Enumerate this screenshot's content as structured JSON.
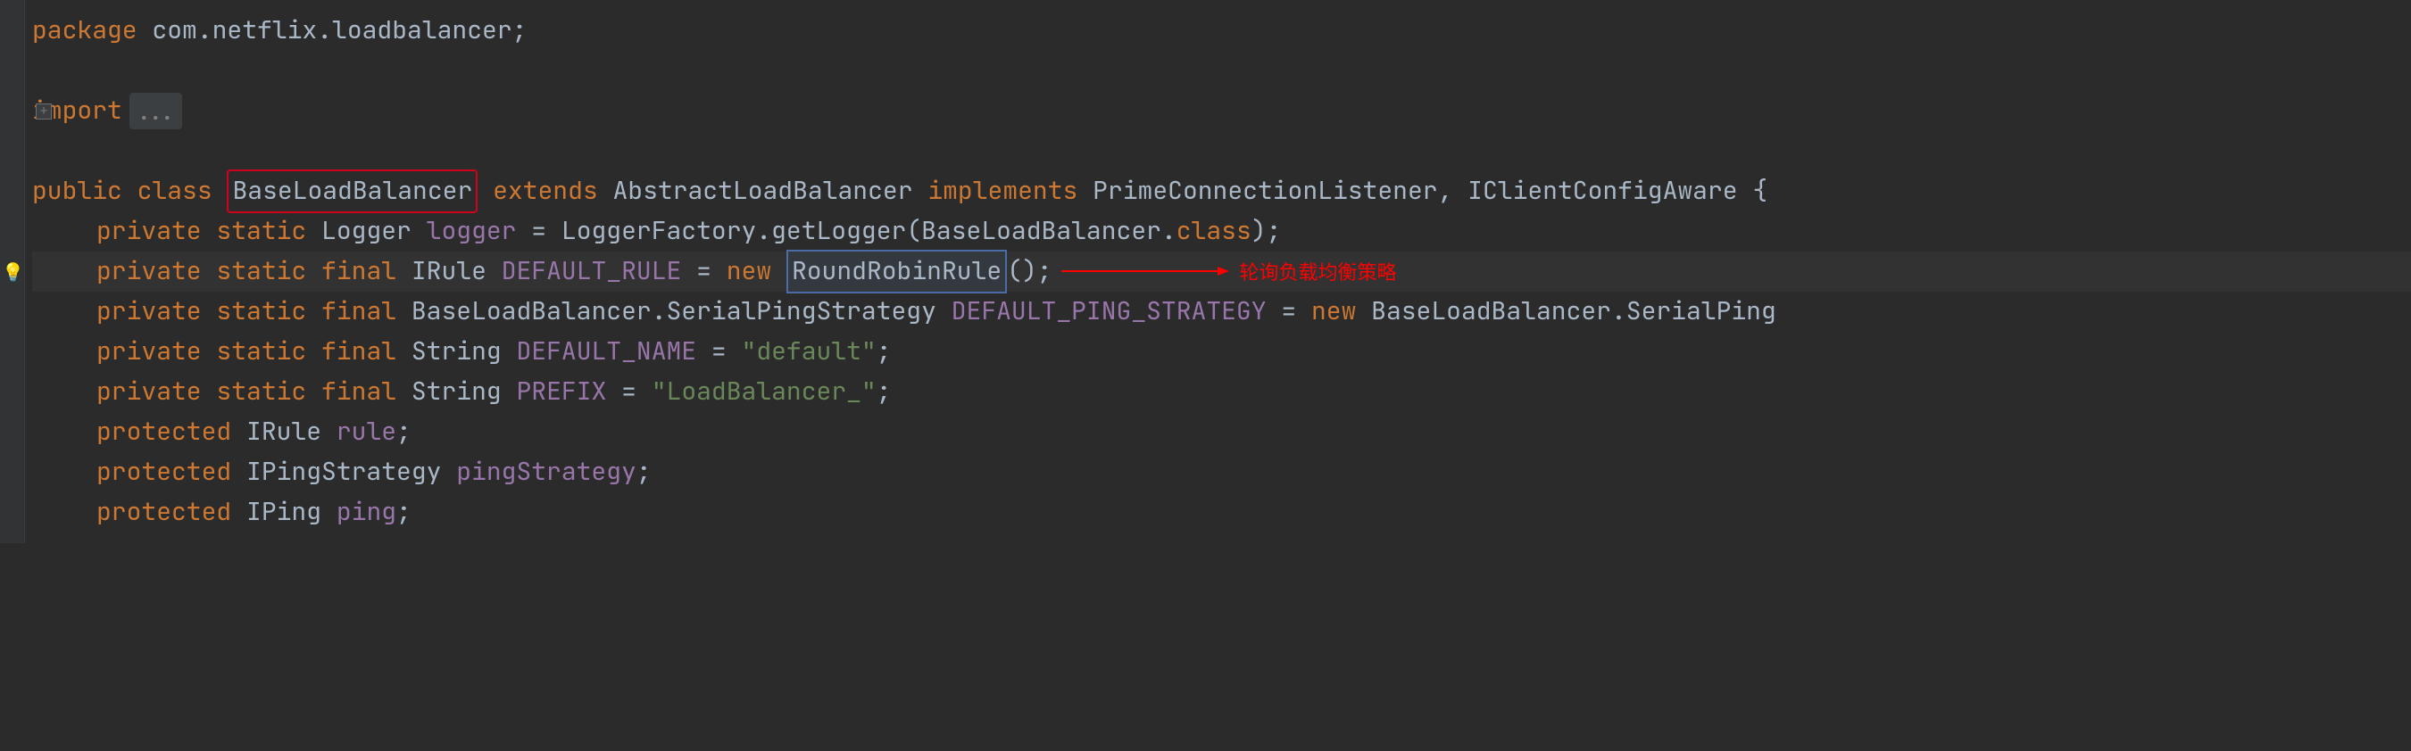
{
  "code": {
    "package_kw": "package",
    "package_name": "com.netflix.loadbalancer",
    "import_kw": "import",
    "import_fold": "...",
    "class_decl": {
      "public_kw": "public",
      "class_kw": "class",
      "class_name": "BaseLoadBalancer",
      "extends_kw": "extends",
      "extends_name": "AbstractLoadBalancer",
      "implements_kw": "implements",
      "impl1": "PrimeConnectionListener",
      "impl2": "IClientConfigAware"
    },
    "line_logger": {
      "private_kw": "private",
      "static_kw": "static",
      "type": "Logger",
      "name": "logger",
      "factory": "LoggerFactory",
      "method": "getLogger",
      "arg": "BaseLoadBalancer",
      "class_kw": "class"
    },
    "line_default_rule": {
      "private_kw": "private",
      "static_kw": "static",
      "final_kw": "final",
      "type": "IRule",
      "name": "DEFAULT_RULE",
      "new_kw": "new",
      "ctor": "RoundRobinRule"
    },
    "line_ping_strategy": {
      "private_kw": "private",
      "static_kw": "static",
      "final_kw": "final",
      "type1": "BaseLoadBalancer",
      "type2": "SerialPingStrategy",
      "name": "DEFAULT_PING_STRATEGY",
      "new_kw": "new",
      "ctor1": "BaseLoadBalancer",
      "ctor2": "SerialPing"
    },
    "line_default_name": {
      "private_kw": "private",
      "static_kw": "static",
      "final_kw": "final",
      "type": "String",
      "name": "DEFAULT_NAME",
      "value": "\"default\""
    },
    "line_prefix": {
      "private_kw": "private",
      "static_kw": "static",
      "final_kw": "final",
      "type": "String",
      "name": "PREFIX",
      "value": "\"LoadBalancer_\""
    },
    "line_rule": {
      "protected_kw": "protected",
      "type": "IRule",
      "name": "rule"
    },
    "line_ping_strategy_field": {
      "protected_kw": "protected",
      "type": "IPingStrategy",
      "name": "pingStrategy"
    },
    "line_ping": {
      "protected_kw": "protected",
      "type": "IPing",
      "name": "ping"
    }
  },
  "annotation": "轮询负载均衡策略",
  "icons": {
    "bulb": "💡",
    "fold_plus": "+"
  }
}
